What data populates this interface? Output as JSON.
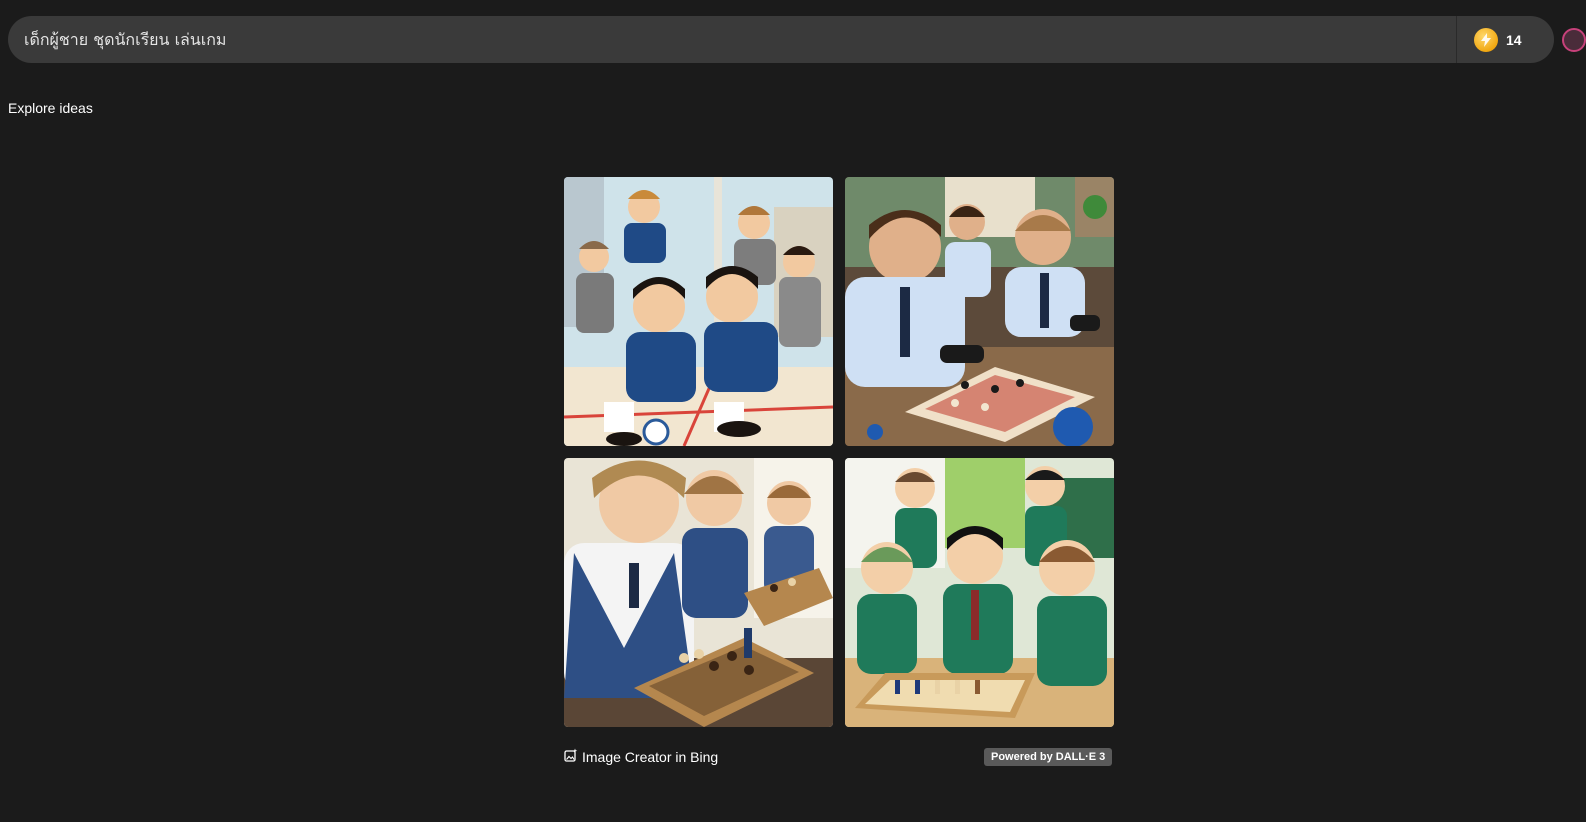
{
  "search": {
    "value": "เด็กผู้ชาย ชุดนักเรียน เล่นเกม"
  },
  "coins": {
    "icon": "lightning-coin-icon",
    "count": "14",
    "accent": "#f1a812"
  },
  "explore": {
    "title": "Explore ideas"
  },
  "results": {
    "images": [
      {
        "name": "image-cartoon-boys-blue-blazers-ball"
      },
      {
        "name": "image-boys-white-shirts-controllers-chess"
      },
      {
        "name": "image-boys-navy-vests-playing-chess"
      },
      {
        "name": "image-cartoon-boys-green-blazers-chess"
      }
    ]
  },
  "footer": {
    "creator_label": "Image Creator in Bing",
    "creator_icon": "image-sparkle-icon",
    "powered_by": "Powered by DALL·E 3"
  },
  "colors": {
    "background": "#1b1b1b",
    "search_bar": "#3a3a3a",
    "badge": "#5a5a5a"
  }
}
